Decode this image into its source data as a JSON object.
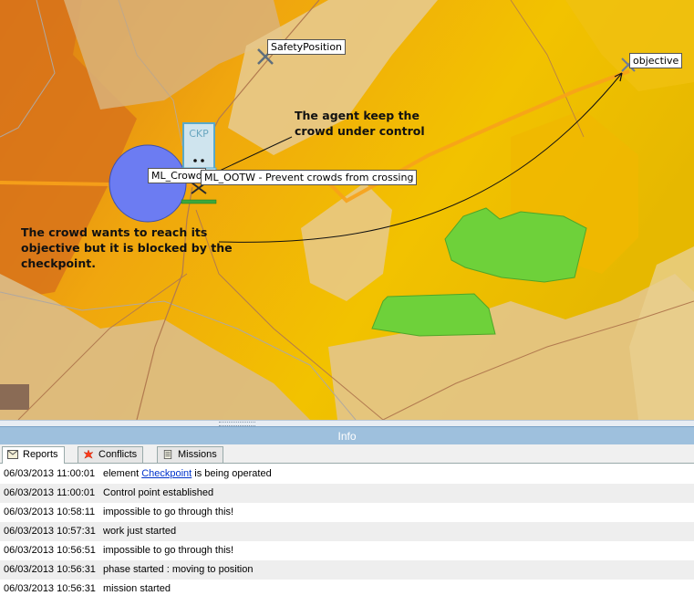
{
  "map": {
    "labels": {
      "safety_position": "SafetyPosition",
      "objective": "objective",
      "ml_crowd": "ML_Crowd",
      "ml_ootw": "ML_OOTW - Prevent crowds from crossing",
      "checkpoint_icon_text": "CKP"
    },
    "annotations": {
      "agent_line1": "The agent keep the",
      "agent_line2": "crowd under control",
      "crowd_line1": "The crowd wants to reach its",
      "crowd_line2": "objective but it is blocked by the",
      "crowd_line3": "checkpoint."
    },
    "colors": {
      "crowd_circle": "#6c7cf2",
      "forest": "#6ed13a",
      "route": "#f7a21a",
      "terrain_dark": "#e07810",
      "terrain_mid": "#f2b400",
      "terrain_light": "#e6c98a"
    }
  },
  "info_panel": {
    "title": "Info",
    "tabs": [
      {
        "label": "Reports",
        "icon": "envelope-icon",
        "active": true
      },
      {
        "label": "Conflicts",
        "icon": "explosion-icon",
        "active": false
      },
      {
        "label": "Missions",
        "icon": "document-icon",
        "active": false
      }
    ],
    "rows": [
      {
        "time": "06/03/2013 11:00:01",
        "pre": "element ",
        "link": "Checkpoint",
        "post": " is being operated"
      },
      {
        "time": "06/03/2013 11:00:01",
        "pre": "Control point established",
        "link": "",
        "post": ""
      },
      {
        "time": "06/03/2013 10:58:11",
        "pre": "impossible to go through this!",
        "link": "",
        "post": ""
      },
      {
        "time": "06/03/2013 10:57:31",
        "pre": "work just started",
        "link": "",
        "post": ""
      },
      {
        "time": "06/03/2013 10:56:51",
        "pre": "impossible to go through this!",
        "link": "",
        "post": ""
      },
      {
        "time": "06/03/2013 10:56:31",
        "pre": "phase started : moving to position",
        "link": "",
        "post": ""
      },
      {
        "time": "06/03/2013 10:56:31",
        "pre": "mission started",
        "link": "",
        "post": ""
      }
    ]
  }
}
